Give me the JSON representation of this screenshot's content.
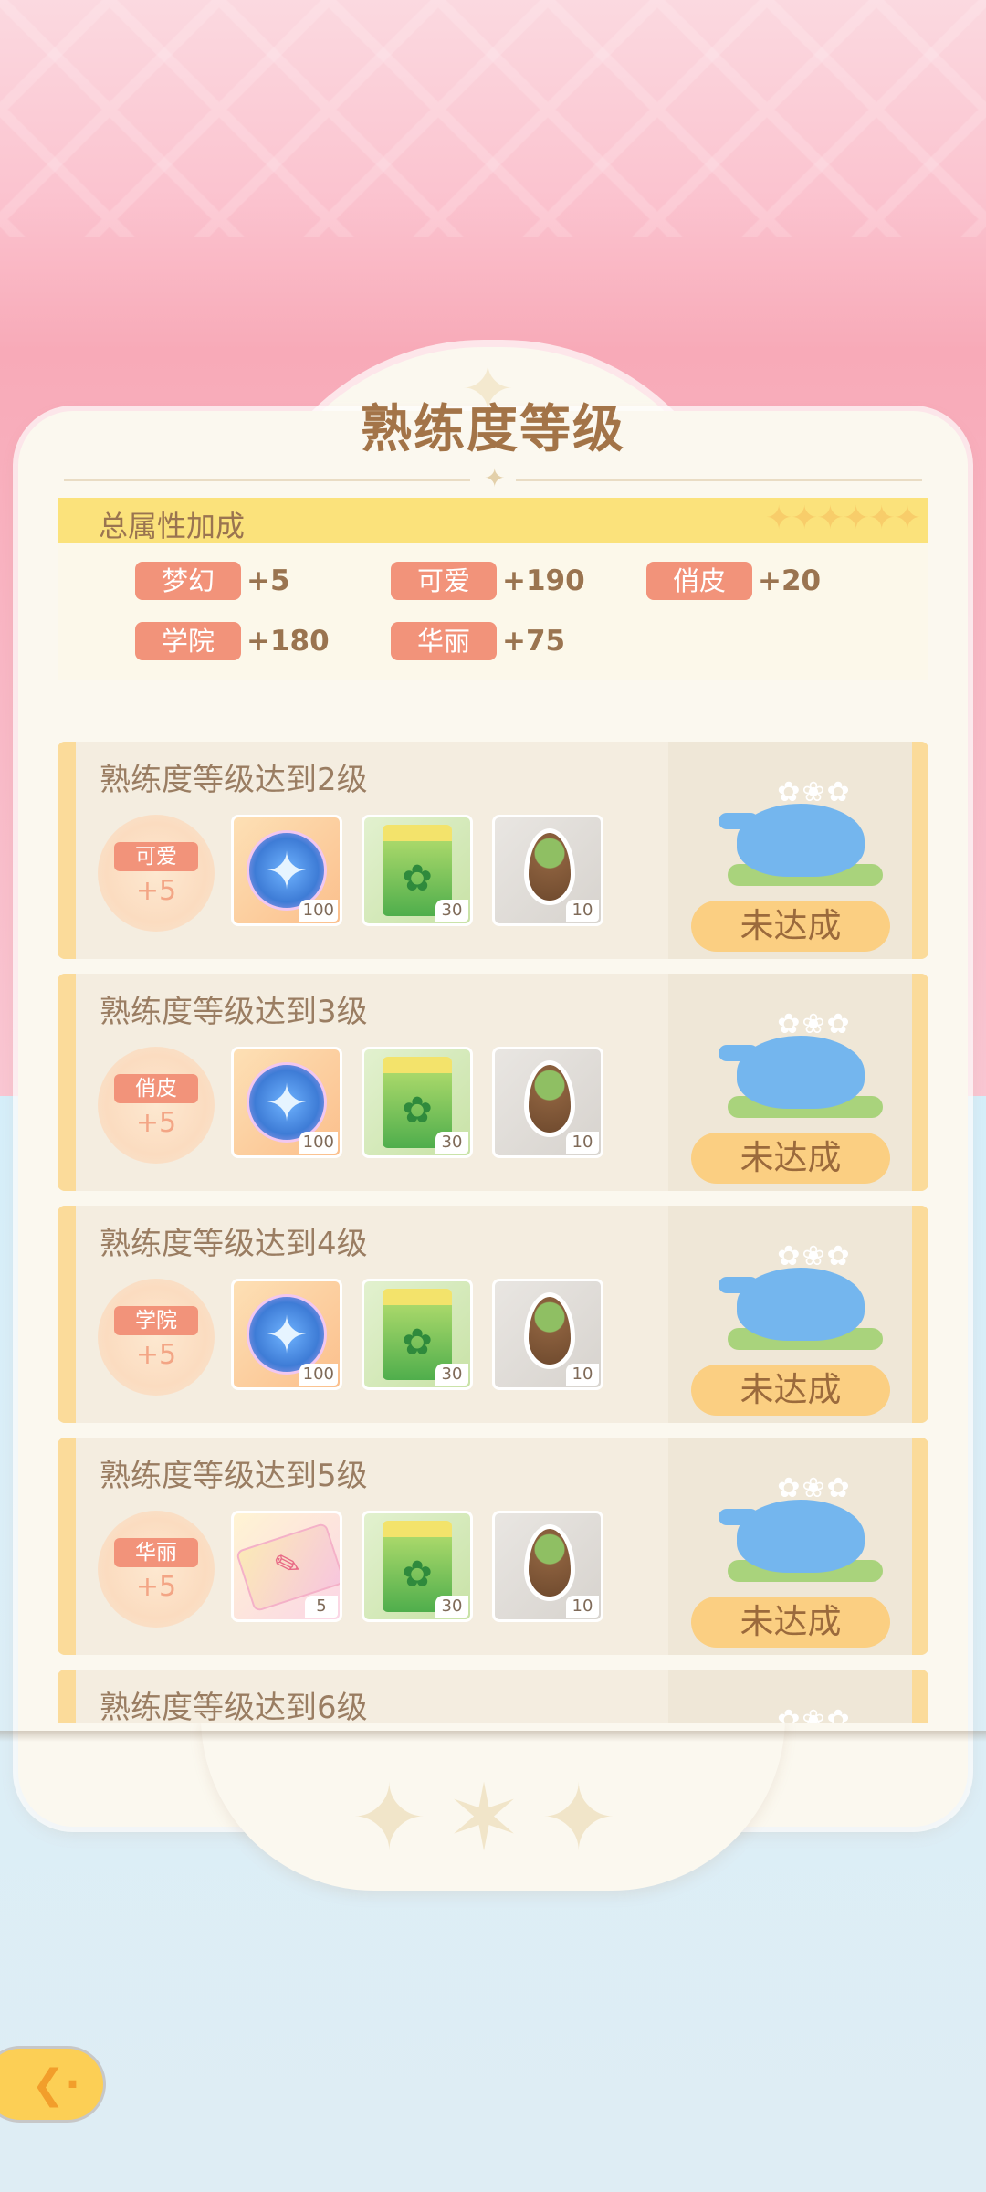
{
  "title": "熟练度等级",
  "bonus": {
    "header": "总属性加成",
    "stars": "✦✦✦✦✦✦",
    "attributes": [
      {
        "name": "梦幻",
        "value": "+5"
      },
      {
        "name": "可爱",
        "value": "+190"
      },
      {
        "name": "俏皮",
        "value": "+20"
      },
      {
        "name": "学院",
        "value": "+180"
      },
      {
        "name": "华丽",
        "value": "+75"
      }
    ]
  },
  "rows": [
    {
      "title": "熟练度等级达到2级",
      "attr": {
        "name": "可爱",
        "value": "+5"
      },
      "items": [
        {
          "icon": "compass-icon",
          "count": "100"
        },
        {
          "icon": "seed-bag-icon",
          "count": "30"
        },
        {
          "icon": "seed-icon",
          "count": "10"
        }
      ],
      "status": "未达成"
    },
    {
      "title": "熟练度等级达到3级",
      "attr": {
        "name": "俏皮",
        "value": "+5"
      },
      "items": [
        {
          "icon": "compass-icon",
          "count": "100"
        },
        {
          "icon": "seed-bag-icon",
          "count": "30"
        },
        {
          "icon": "seed-icon",
          "count": "10"
        }
      ],
      "status": "未达成"
    },
    {
      "title": "熟练度等级达到4级",
      "attr": {
        "name": "学院",
        "value": "+5"
      },
      "items": [
        {
          "icon": "compass-icon",
          "count": "100"
        },
        {
          "icon": "seed-bag-icon",
          "count": "30"
        },
        {
          "icon": "seed-icon",
          "count": "10"
        }
      ],
      "status": "未达成"
    },
    {
      "title": "熟练度等级达到5级",
      "attr": {
        "name": "华丽",
        "value": "+5"
      },
      "items": [
        {
          "icon": "ticket-icon",
          "count": "5"
        },
        {
          "icon": "seed-bag-icon",
          "count": "30"
        },
        {
          "icon": "seed-icon",
          "count": "10"
        }
      ],
      "status": "未达成"
    },
    {
      "title": "熟练度等级达到6级"
    }
  ],
  "back_button": {
    "icon": "back-arrow-icon"
  }
}
